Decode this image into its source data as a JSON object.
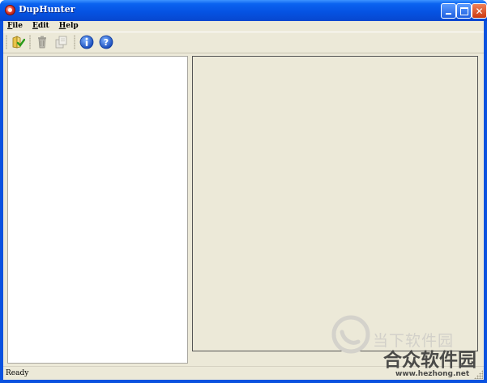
{
  "window": {
    "title": "DupHunter"
  },
  "menu": [
    {
      "label": "File"
    },
    {
      "label": "Edit"
    },
    {
      "label": "Help"
    }
  ],
  "toolbar": {
    "buttons": [
      {
        "icon": "open-folder-icon",
        "enabled": true
      },
      {
        "icon": "trash-icon",
        "enabled": false
      },
      {
        "icon": "copy-icon",
        "enabled": false
      },
      {
        "icon": "info-icon",
        "enabled": true
      },
      {
        "icon": "help-icon",
        "enabled": true
      }
    ]
  },
  "status": {
    "text": "Ready"
  },
  "watermark": {
    "line1": "当下软件园",
    "line2": "合众软件园",
    "line3": "www.hezhong.net"
  },
  "colors": {
    "titlebar": "#0553e3",
    "window_bg": "#ece9d8",
    "close_button": "#cc3a11",
    "info_blue": "#1f5fd0"
  }
}
